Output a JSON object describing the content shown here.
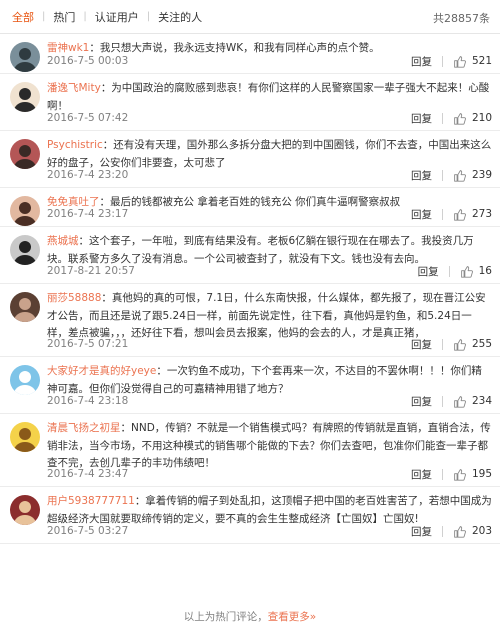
{
  "tabs": [
    "全部",
    "热门",
    "认证用户",
    "关注的人"
  ],
  "total_count": "共28857条",
  "reply_label": "回复",
  "comments": [
    {
      "user": "雷神wk1",
      "text": "：我只想大声说，我永远支持WK，和我有同样心声的点个赞。",
      "time": "2016-7-5 00:03",
      "likes": "521"
    },
    {
      "user": "潘逸飞Mity",
      "text": "：为中国政治的腐败感到悲哀！有你们这样的人民警察国家一辈子强大不起来！心酸啊！",
      "time": "2016-7-5 07:42",
      "likes": "210"
    },
    {
      "user": "Psychistric",
      "text": "：还有没有天理，国外那么多拆分盘大把的到中国圈钱，你们不去查，中国出来这么好的盘子，公安你们非要查，太可悲了",
      "time": "2016-7-4 23:20",
      "likes": "239"
    },
    {
      "user": "免免真吐了",
      "text": "：最后的钱都被充公 拿着老百姓的钱充公 你们真牛逼啊警察叔叔",
      "time": "2016-7-4 23:17",
      "likes": "273"
    },
    {
      "user": "燕城城",
      "text": "：这个套子，一年啦，到底有结果没有。老板6亿躺在银行现在在哪去了。我投资几万块。联系警方多久了没有消息。一个公司被查封了，就没有下文。钱也没有去向。",
      "time": "2017-8-21 20:57",
      "likes": "16"
    },
    {
      "user": "丽莎58888",
      "text": "：真他妈的真的可恨，7.1日，什么东南快报，什么媒体，都先报了，现在晋江公安才公告，而且还是说了跟5.24日一样，前面先说定性，往下看，真他妈是钓鱼，和5.24日一样，差点被骗，，，还好往下看，想叫会员去报案，他妈的会去的人，才是真正猪，",
      "time": "2016-7-5 07:21",
      "likes": "255"
    },
    {
      "user": "大家好才是真的好yeye",
      "text": "：一次钓鱼不成功，下个套再来一次，不达目的不罢休啊！！！你们精神可嘉。但你们没觉得自己的可嘉精神用错了地方？",
      "time": "2016-7-4 23:18",
      "likes": "234"
    },
    {
      "user": "清晨飞扬之初星",
      "text": "：NND，传销？不就是一个销售模式吗？有牌照的传销就是直销，直销合法，传销非法，当今市场，不用这种模式的销售哪个能做的下去？你们去查吧，包准你们能查一辈子都查不完，去创几辈子的丰功伟绩吧！",
      "time": "2016-7-4 23:47",
      "likes": "195"
    },
    {
      "user": "用户5938777711",
      "text": "：拿着传销的帽子到处乱扣，这顶帽子把中国的老百姓害苦了，若想中国成为超级经济大国就要取缔传销的定义，要不真的会生生整成经济【亡国奴】亡国奴!",
      "time": "2016-7-5 03:27",
      "likes": "203"
    }
  ],
  "footer": {
    "prefix": "以上为热门评论，",
    "link": "查看更多»"
  },
  "colors": {
    "accent": "#e8540f",
    "username": "#eb7350",
    "meta": "#808080"
  },
  "icons": [
    "thumbs-up-icon",
    "avatar"
  ]
}
